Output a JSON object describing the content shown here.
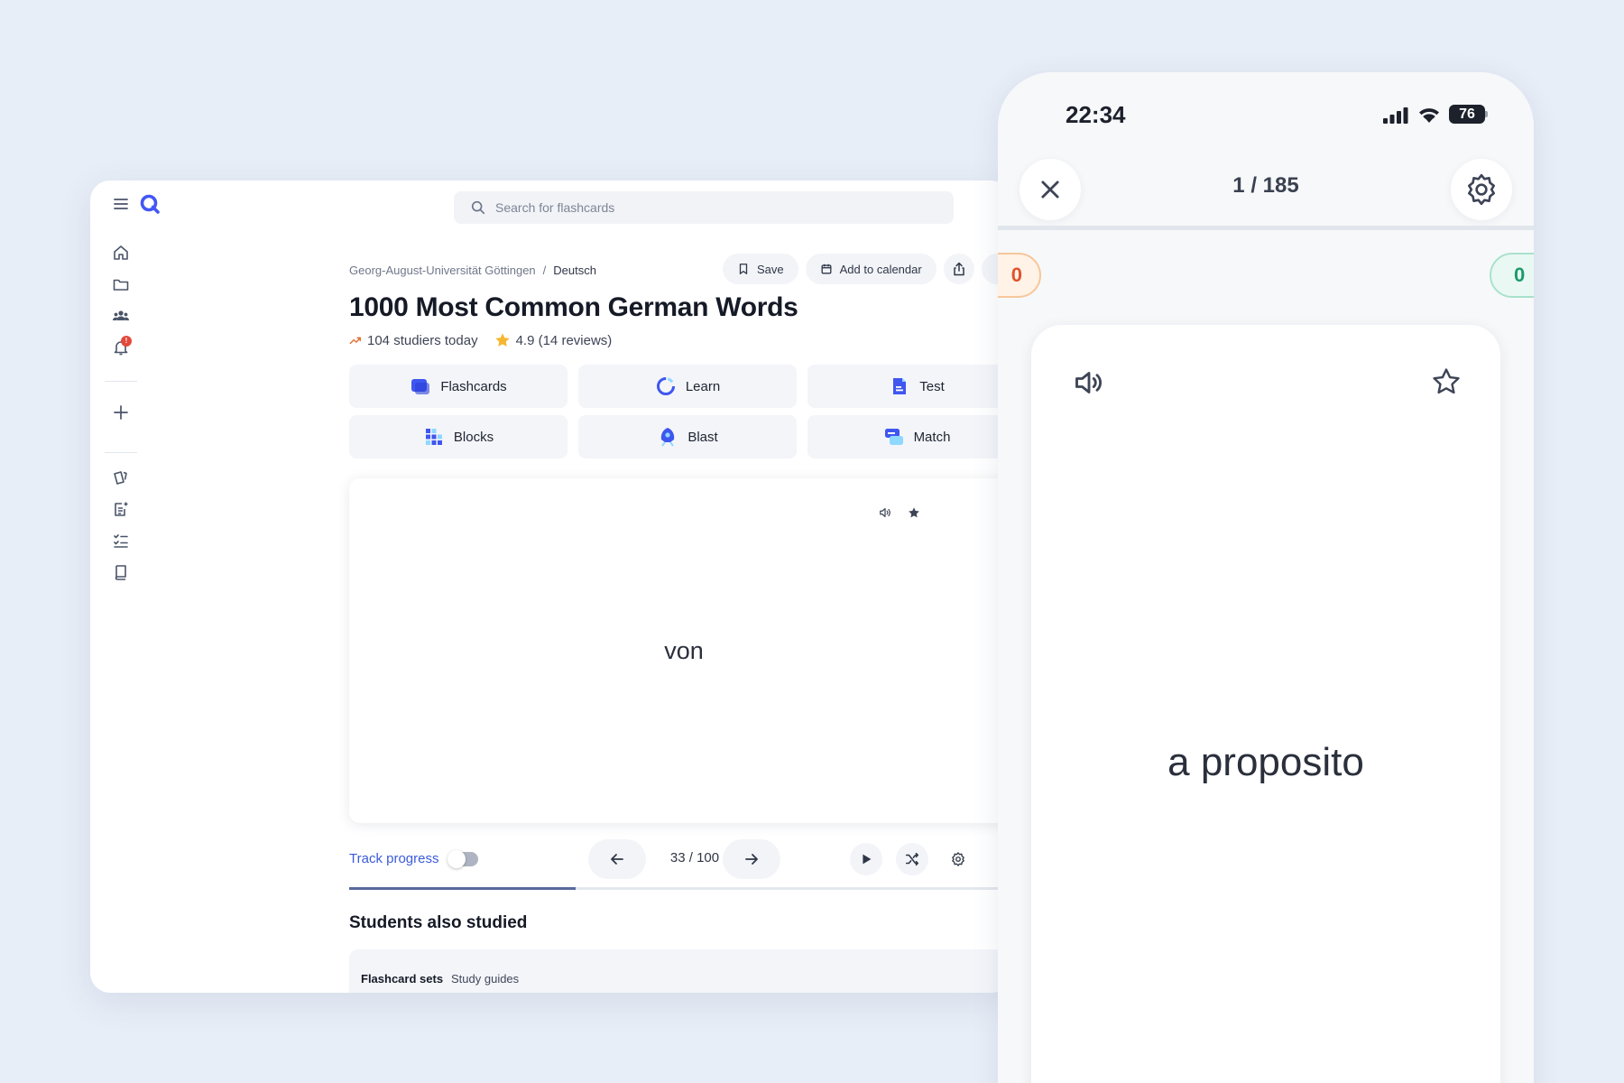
{
  "desktop": {
    "search": {
      "placeholder": "Search for flashcards"
    },
    "breadcrumb": {
      "school": "Georg-August-Universität Göttingen",
      "separator": "/",
      "subject": "Deutsch"
    },
    "actions": {
      "save": "Save",
      "calendar": "Add to calendar"
    },
    "title": "1000 Most Common German Words",
    "meta": {
      "studiers": "104 studiers today",
      "rating": "4.9 (14 reviews)"
    },
    "modes": [
      {
        "label": "Flashcards",
        "icon": "flashcards-icon"
      },
      {
        "label": "Learn",
        "icon": "learn-icon"
      },
      {
        "label": "Test",
        "icon": "test-icon"
      },
      {
        "label": "Blocks",
        "icon": "blocks-icon"
      },
      {
        "label": "Blast",
        "icon": "blast-icon"
      },
      {
        "label": "Match",
        "icon": "match-icon"
      }
    ],
    "card": {
      "word": "von"
    },
    "controls": {
      "track_label": "Track progress",
      "track_enabled": false,
      "counter": "33 / 100",
      "progress_fraction": 0.33
    },
    "also": {
      "heading": "Students also studied",
      "tabs": [
        "Flashcard sets",
        "Study guides"
      ]
    },
    "notification_badge": "!",
    "colors": {
      "accent": "#3b5bdb",
      "background": "#e8eef7"
    }
  },
  "phone": {
    "time": "22:34",
    "battery": "76",
    "counter": "1 / 185",
    "wrong_count": "0",
    "right_count": "0",
    "card_word": "a proposito"
  }
}
